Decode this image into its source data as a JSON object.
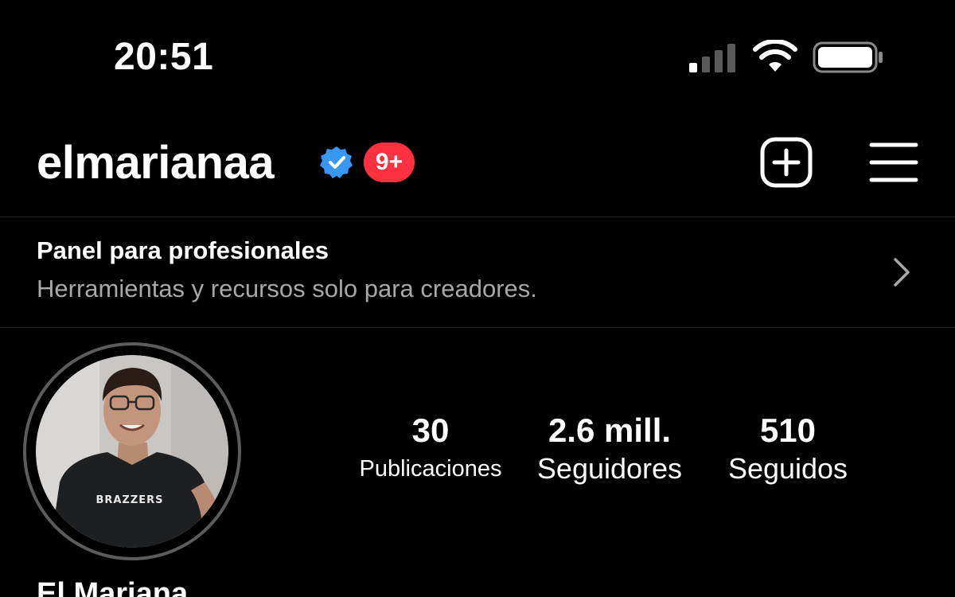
{
  "status_bar": {
    "time": "20:51",
    "signal_icon": "cellular-signal-icon",
    "wifi_icon": "wifi-icon",
    "battery_icon": "battery-icon"
  },
  "header": {
    "username": "elmarianaa",
    "verified_icon": "verified-badge-icon",
    "notification_count": "9+",
    "new_post_icon": "plus-square-icon",
    "menu_icon": "hamburger-menu-icon"
  },
  "professional_panel": {
    "title": "Panel para profesionales",
    "subtitle": "Herramientas y recursos solo para creadores.",
    "chevron_icon": "chevron-right-icon"
  },
  "profile": {
    "avatar_shirt_text": "BRAZZERS",
    "display_name": "El Mariana",
    "stats": {
      "posts": {
        "value": "30",
        "label": "Publicaciones"
      },
      "followers": {
        "value": "2.6 mill.",
        "label": "Seguidores"
      },
      "following": {
        "value": "510",
        "label": "Seguidos"
      }
    }
  },
  "colors": {
    "background": "#000000",
    "text_primary": "#ffffff",
    "text_secondary": "#a8a8a8",
    "divider": "#262626",
    "badge_red": "#ff3040",
    "verified_blue": "#3897f0",
    "avatar_ring": "#5c5c5c"
  }
}
